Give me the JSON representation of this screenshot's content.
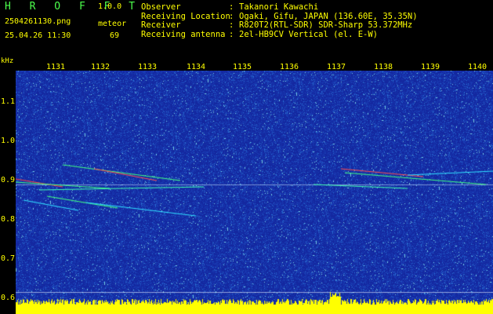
{
  "header": {
    "app_title": "H R O F F T",
    "version": "1.0.0",
    "filename": "2504261130.png",
    "mode": "meteor",
    "datetime": "25.04.26 11:30",
    "count": "69"
  },
  "info": [
    {
      "key": "Observer",
      "sep": ":",
      "value": "Takanori Kawachi"
    },
    {
      "key": "Receiving Location",
      "sep": ":",
      "value": "Ogaki, Gifu, JAPAN (136.60E, 35.35N)"
    },
    {
      "key": "Receiver",
      "sep": ":",
      "value": "R820T2(RTL-SDR) SDR-Sharp 53.372MHz"
    },
    {
      "key": "Receiving antenna",
      "sep": ":",
      "value": "2el-HB9CV Vertical (el. E-W)"
    }
  ],
  "axes": {
    "y_unit": "kHz",
    "x_ticks": [
      "1131",
      "1132",
      "1133",
      "1134",
      "1135",
      "1136",
      "1137",
      "1138",
      "1139",
      "1140"
    ],
    "y_ticks": [
      "1.1",
      "1.0",
      "0.9",
      "0.8",
      "0.7",
      "0.6"
    ]
  },
  "colors": {
    "accent": "#ffff00",
    "title": "#4cff4c",
    "background": "#1a2ea8",
    "spectrum": "#ffff00"
  }
}
